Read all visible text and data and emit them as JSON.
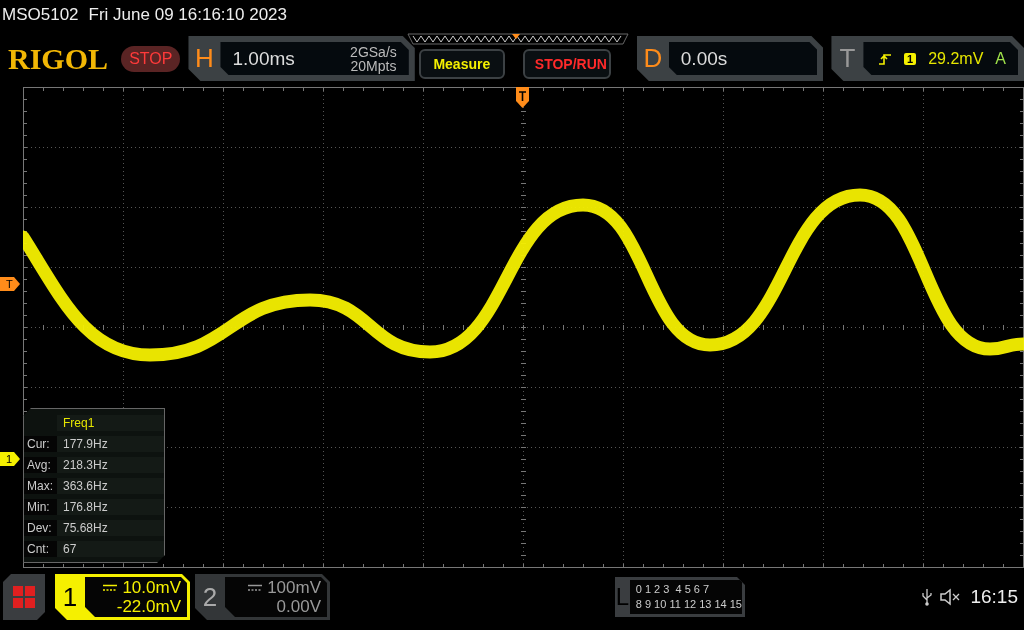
{
  "status_line": {
    "model": "MSO5102",
    "datetime": "Fri June 09 16:16:10 2023"
  },
  "logo": "RIGOL",
  "run_state": {
    "label": "STOP"
  },
  "horizontal": {
    "letter": "H",
    "timebase": "1.00ms",
    "sample_rate": "2GSa/s",
    "memory_depth": "20Mpts"
  },
  "buttons": [
    {
      "label": "Measure",
      "kind": "measure"
    },
    {
      "label": "STOP/RUN",
      "kind": "stoprun"
    }
  ],
  "delay": {
    "letter": "D",
    "value": "0.00s"
  },
  "trigger": {
    "letter": "T",
    "source": "1",
    "level": "29.2mV",
    "mode": "A"
  },
  "markers": {
    "trigger_level": "T",
    "channel": "1"
  },
  "measurement": {
    "title": "Freq1",
    "rows": [
      {
        "label": "Cur:",
        "value": "177.9Hz"
      },
      {
        "label": "Avg:",
        "value": "218.3Hz"
      },
      {
        "label": "Max:",
        "value": "363.6Hz"
      },
      {
        "label": "Min:",
        "value": "176.8Hz"
      },
      {
        "label": "Dev:",
        "value": "75.68Hz"
      },
      {
        "label": "Cnt:",
        "value": "67"
      }
    ]
  },
  "channels": [
    {
      "number": "1",
      "scale": "10.0mV",
      "offset": "-22.0mV",
      "selected": true
    },
    {
      "number": "2",
      "scale": "100mV",
      "offset": "0.00V",
      "selected": false
    }
  ],
  "logic": {
    "letter": "L",
    "rows": [
      "0 1 2 3  4 5 6 7",
      "8 9 10 11 12 13 14 15"
    ]
  },
  "clock": "16:15"
}
